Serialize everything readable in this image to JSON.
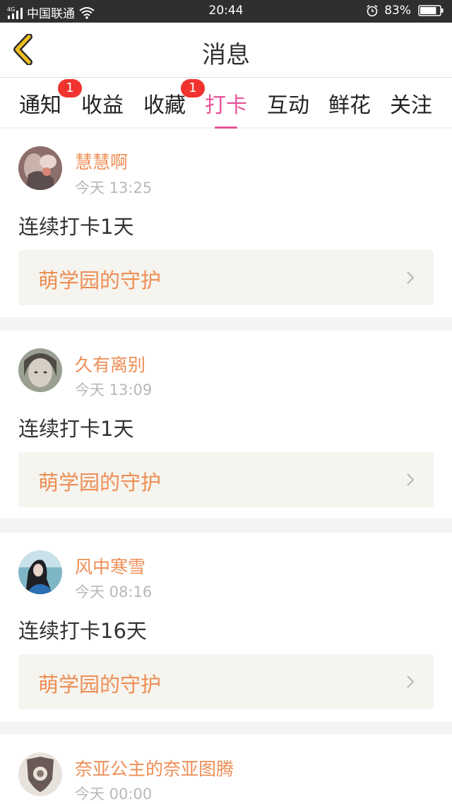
{
  "status_bar": {
    "network": "4G",
    "carrier": "中国联通",
    "time": "20:44",
    "battery": "83%",
    "battery_level": 0.83
  },
  "header": {
    "title": "消息"
  },
  "tabs": [
    {
      "label": "通知",
      "badge": "1"
    },
    {
      "label": "收益",
      "badge": ""
    },
    {
      "label": "收藏",
      "badge": "1"
    },
    {
      "label": "打卡",
      "badge": "",
      "active": true
    },
    {
      "label": "互动",
      "badge": ""
    },
    {
      "label": "鲜花",
      "badge": ""
    },
    {
      "label": "关注",
      "badge": ""
    }
  ],
  "messages": [
    {
      "user": "慧慧啊",
      "time": "今天 13:25",
      "text": "连续打卡1天",
      "link": "萌学园的守护"
    },
    {
      "user": "久有离别",
      "time": "今天 13:09",
      "text": "连续打卡1天",
      "link": "萌学园的守护"
    },
    {
      "user": "风中寒雪",
      "time": "今天 08:16",
      "text": "连续打卡16天",
      "link": "萌学园的守护"
    },
    {
      "user": "奈亚公主的奈亚图腾",
      "time": "今天 00:00"
    }
  ],
  "colors": {
    "accent": "#e8559a",
    "username": "#ee8e55",
    "badge": "#f0332e",
    "back_icon": "#f0c020"
  }
}
